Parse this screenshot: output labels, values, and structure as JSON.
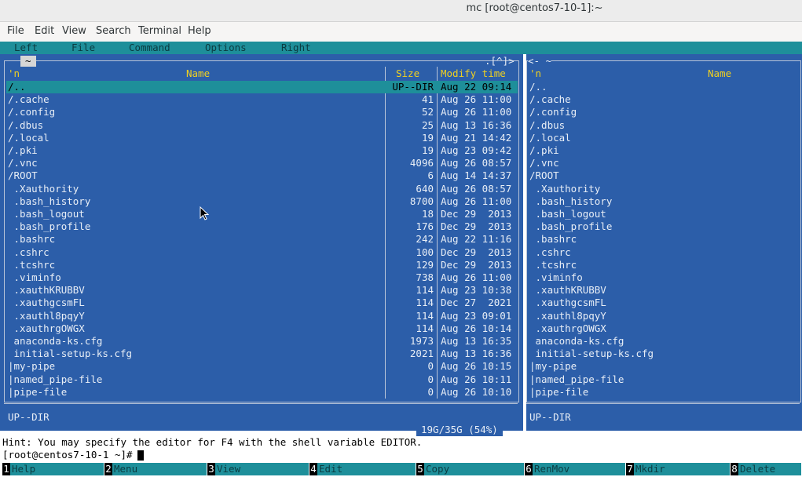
{
  "window": {
    "title": "mc [root@centos7-10-1]:~"
  },
  "gnome_menu": [
    "File",
    "Edit",
    "View",
    "Search",
    "Terminal",
    "Help"
  ],
  "mc_menu": [
    "Left",
    "File",
    "Command",
    "Options",
    "Right"
  ],
  "left_panel": {
    "path_tab": "~",
    "top_right_marker": ".[^]>",
    "header": {
      "sort": "'n",
      "name": "Name",
      "size": "Size",
      "mtime": "Modify time"
    },
    "rows": [
      {
        "name": "/..",
        "size": "UP--DIR",
        "mtime": "Aug 22 09:14",
        "selected": true
      },
      {
        "name": "/.cache",
        "size": "41",
        "mtime": "Aug 26 11:00"
      },
      {
        "name": "/.config",
        "size": "52",
        "mtime": "Aug 26 11:00"
      },
      {
        "name": "/.dbus",
        "size": "25",
        "mtime": "Aug 13 16:36"
      },
      {
        "name": "/.local",
        "size": "19",
        "mtime": "Aug 21 14:42"
      },
      {
        "name": "/.pki",
        "size": "19",
        "mtime": "Aug 23 09:42"
      },
      {
        "name": "/.vnc",
        "size": "4096",
        "mtime": "Aug 26 08:57"
      },
      {
        "name": "/ROOT",
        "size": "6",
        "mtime": "Aug 14 14:37"
      },
      {
        "name": " .Xauthority",
        "size": "640",
        "mtime": "Aug 26 08:57"
      },
      {
        "name": " .bash_history",
        "size": "8700",
        "mtime": "Aug 26 11:00"
      },
      {
        "name": " .bash_logout",
        "size": "18",
        "mtime": "Dec 29  2013"
      },
      {
        "name": " .bash_profile",
        "size": "176",
        "mtime": "Dec 29  2013"
      },
      {
        "name": " .bashrc",
        "size": "242",
        "mtime": "Aug 22 11:16"
      },
      {
        "name": " .cshrc",
        "size": "100",
        "mtime": "Dec 29  2013"
      },
      {
        "name": " .tcshrc",
        "size": "129",
        "mtime": "Dec 29  2013"
      },
      {
        "name": " .viminfo",
        "size": "738",
        "mtime": "Aug 26 11:00"
      },
      {
        "name": " .xauthKRUBBV",
        "size": "114",
        "mtime": "Aug 23 10:38"
      },
      {
        "name": " .xauthgcsmFL",
        "size": "114",
        "mtime": "Dec 27  2021"
      },
      {
        "name": " .xauthl8pqyY",
        "size": "114",
        "mtime": "Aug 23 09:01"
      },
      {
        "name": " .xauthrgOWGX",
        "size": "114",
        "mtime": "Aug 26 10:14"
      },
      {
        "name": " anaconda-ks.cfg",
        "size": "1973",
        "mtime": "Aug 13 16:35"
      },
      {
        "name": " initial-setup-ks.cfg",
        "size": "2021",
        "mtime": "Aug 13 16:36"
      },
      {
        "name": "|my-pipe",
        "size": "0",
        "mtime": "Aug 26 10:15"
      },
      {
        "name": "|named_pipe-file",
        "size": "0",
        "mtime": "Aug 26 10:11"
      },
      {
        "name": "|pipe-file",
        "size": "0",
        "mtime": "Aug 26 10:10"
      }
    ],
    "status": "UP--DIR",
    "disk_info": "19G/35G (54%)"
  },
  "right_panel": {
    "path_tab": "<- ~",
    "header": {
      "sort": "'n",
      "name": "Name"
    },
    "rows": [
      "/..",
      "/.cache",
      "/.config",
      "/.dbus",
      "/.local",
      "/.pki",
      "/.vnc",
      "/ROOT",
      " .Xauthority",
      " .bash_history",
      " .bash_logout",
      " .bash_profile",
      " .bashrc",
      " .cshrc",
      " .tcshrc",
      " .viminfo",
      " .xauthKRUBBV",
      " .xauthgcsmFL",
      " .xauthl8pqyY",
      " .xauthrgOWGX",
      " anaconda-ks.cfg",
      " initial-setup-ks.cfg",
      "|my-pipe",
      "|named_pipe-file",
      "|pipe-file"
    ],
    "status": "UP--DIR"
  },
  "hint": "Hint: You may specify the editor for F4 with the shell variable EDITOR.",
  "prompt": "[root@centos7-10-1 ~]#",
  "fkeys": [
    {
      "num": "1",
      "label": "Help"
    },
    {
      "num": "2",
      "label": "Menu"
    },
    {
      "num": "3",
      "label": "View"
    },
    {
      "num": "4",
      "label": "Edit"
    },
    {
      "num": "5",
      "label": "Copy"
    },
    {
      "num": "6",
      "label": "RenMov"
    },
    {
      "num": "7",
      "label": "Mkdir"
    },
    {
      "num": "8",
      "label": "Delete"
    }
  ],
  "colors": {
    "panel_bg": "#2c5ea9",
    "accent": "#1e8f9a",
    "header": "#f0d020"
  }
}
